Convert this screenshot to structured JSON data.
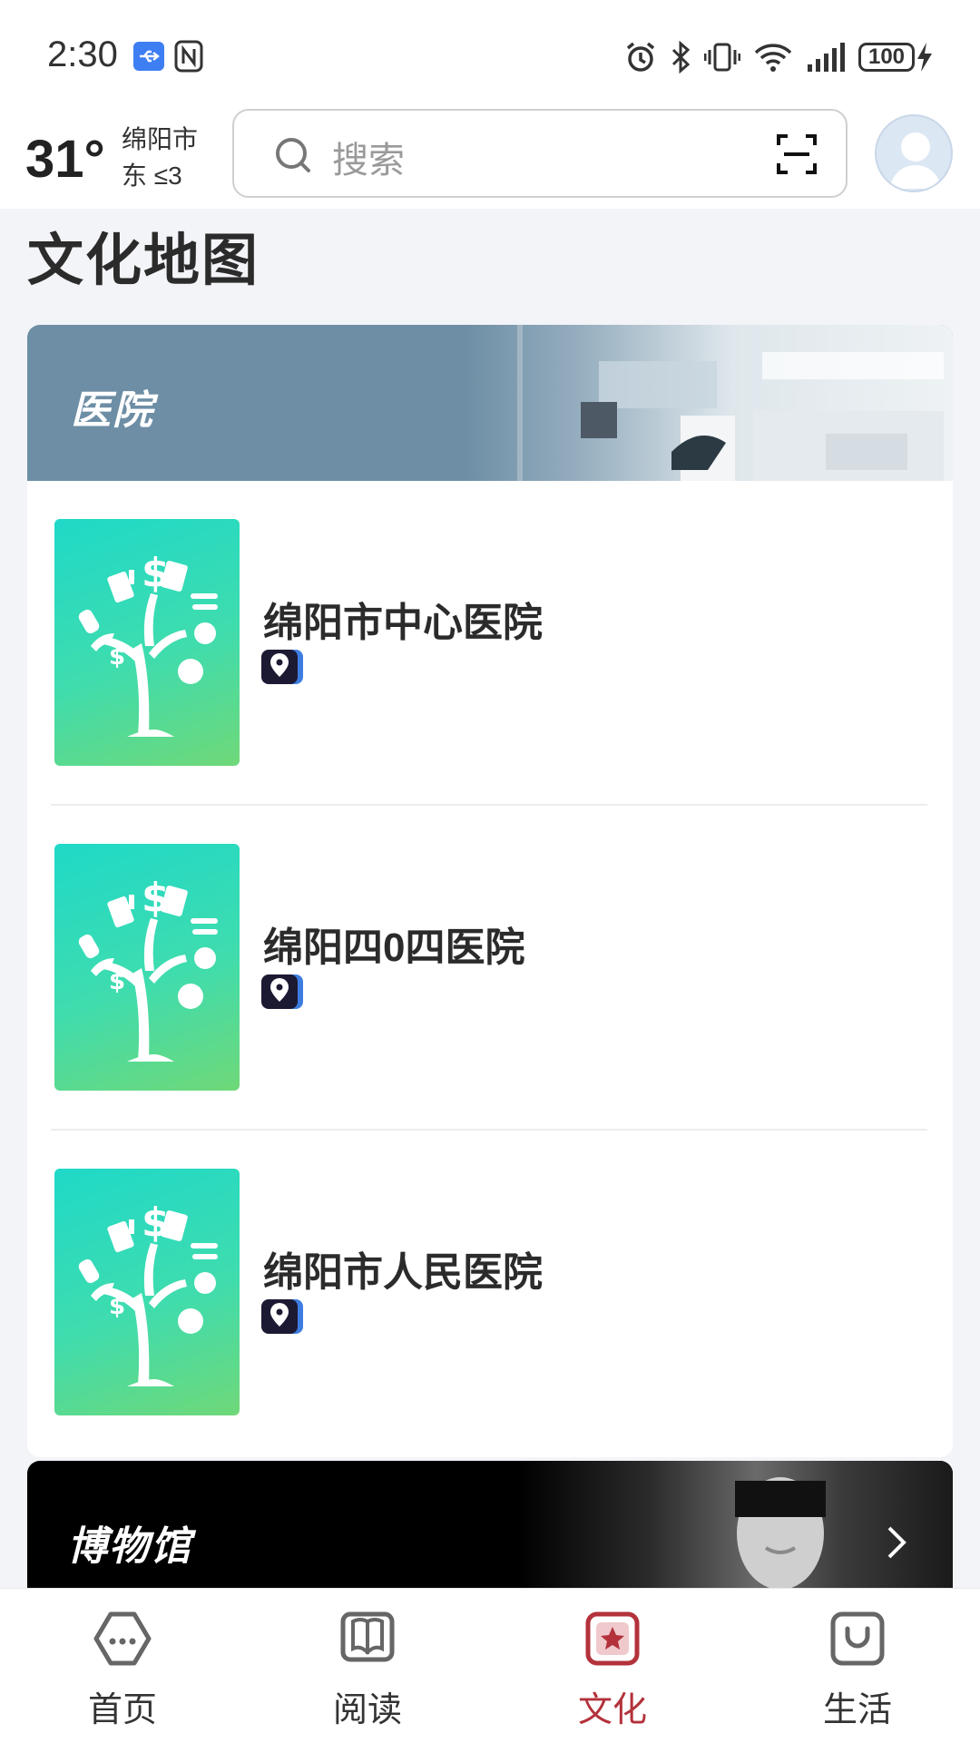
{
  "status_bar": {
    "time": "2:30",
    "battery": "100"
  },
  "header": {
    "temperature": "31°",
    "city": "绵阳市",
    "wind": "东  ≤3",
    "search_placeholder": "搜索"
  },
  "page": {
    "title": "文化地图"
  },
  "hospital_section": {
    "title": "医院",
    "items": [
      {
        "name": "绵阳市中心医院"
      },
      {
        "name": "绵阳四0四医院"
      },
      {
        "name": "绵阳市人民医院"
      }
    ]
  },
  "museum_section": {
    "title": "博物馆"
  },
  "bottom_nav": {
    "items": [
      {
        "label": "首页",
        "icon": "home-icon",
        "active": false
      },
      {
        "label": "阅读",
        "icon": "book-icon",
        "active": false
      },
      {
        "label": "文化",
        "icon": "star-icon",
        "active": true
      },
      {
        "label": "生活",
        "icon": "bag-icon",
        "active": false
      }
    ]
  },
  "colors": {
    "accent": "#b3323b",
    "banner_hospital": "#6d8ea5",
    "thumb_gradient_start": "#1fd9c8",
    "thumb_gradient_end": "#6fd878"
  }
}
